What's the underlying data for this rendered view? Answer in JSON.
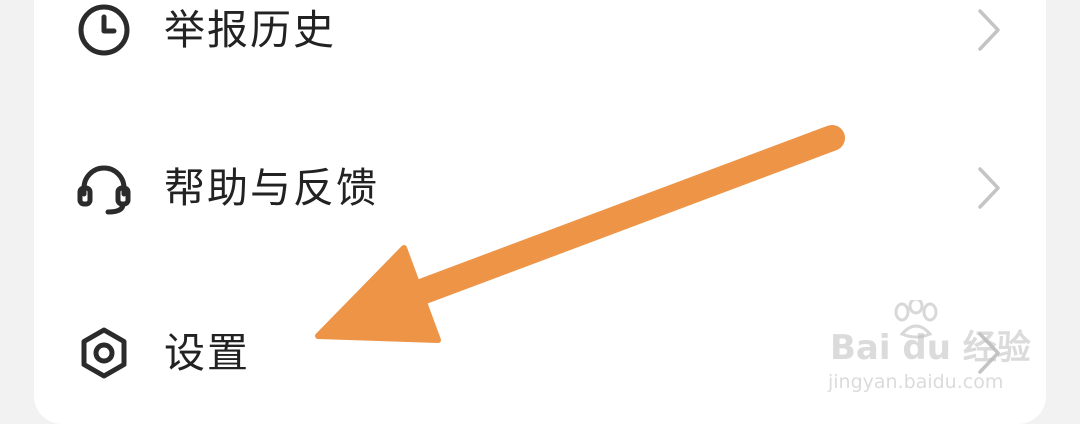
{
  "menu": {
    "items": [
      {
        "label": "举报历史",
        "icon": "clock-icon",
        "chevron": "chevron-right-icon"
      },
      {
        "label": "帮助与反馈",
        "icon": "headset-icon",
        "chevron": "chevron-right-icon"
      },
      {
        "label": "设置",
        "icon": "hexagon-settings-icon",
        "chevron": "chevron-right-icon"
      }
    ]
  },
  "annotation": {
    "type": "arrow",
    "color": "#ED9447",
    "points_to": "设置"
  },
  "watermark": {
    "brand": "Bai du 经验",
    "url": "jingyan.baidu.com"
  },
  "colors": {
    "text": "#222222",
    "icon": "#2b2b2b",
    "chevron": "#c4c4c4",
    "card": "#ffffff",
    "background": "#f2f2f2"
  }
}
